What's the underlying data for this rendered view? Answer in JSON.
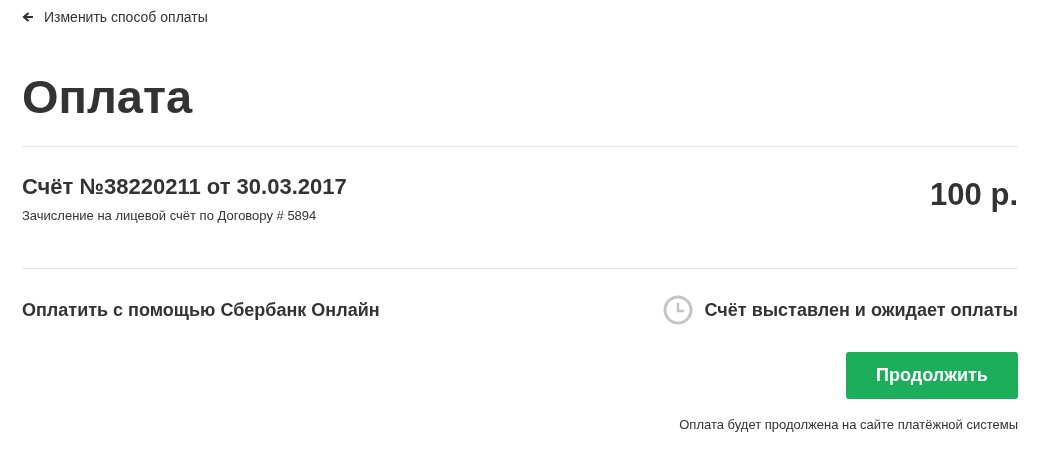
{
  "back_link": {
    "label": "Изменить способ оплаты"
  },
  "title": "Оплата",
  "invoice": {
    "title": "Счёт №38220211 от 30.03.2017",
    "description": "Зачисление на лицевой счёт по Договору # 5894",
    "amount": "100 р."
  },
  "payment": {
    "method": "Оплатить с помощью Сбербанк Онлайн",
    "status": "Счёт выставлен и ожидает оплаты",
    "button": "Продолжить",
    "note": "Оплата будет продолжена на сайте платёжной системы"
  }
}
